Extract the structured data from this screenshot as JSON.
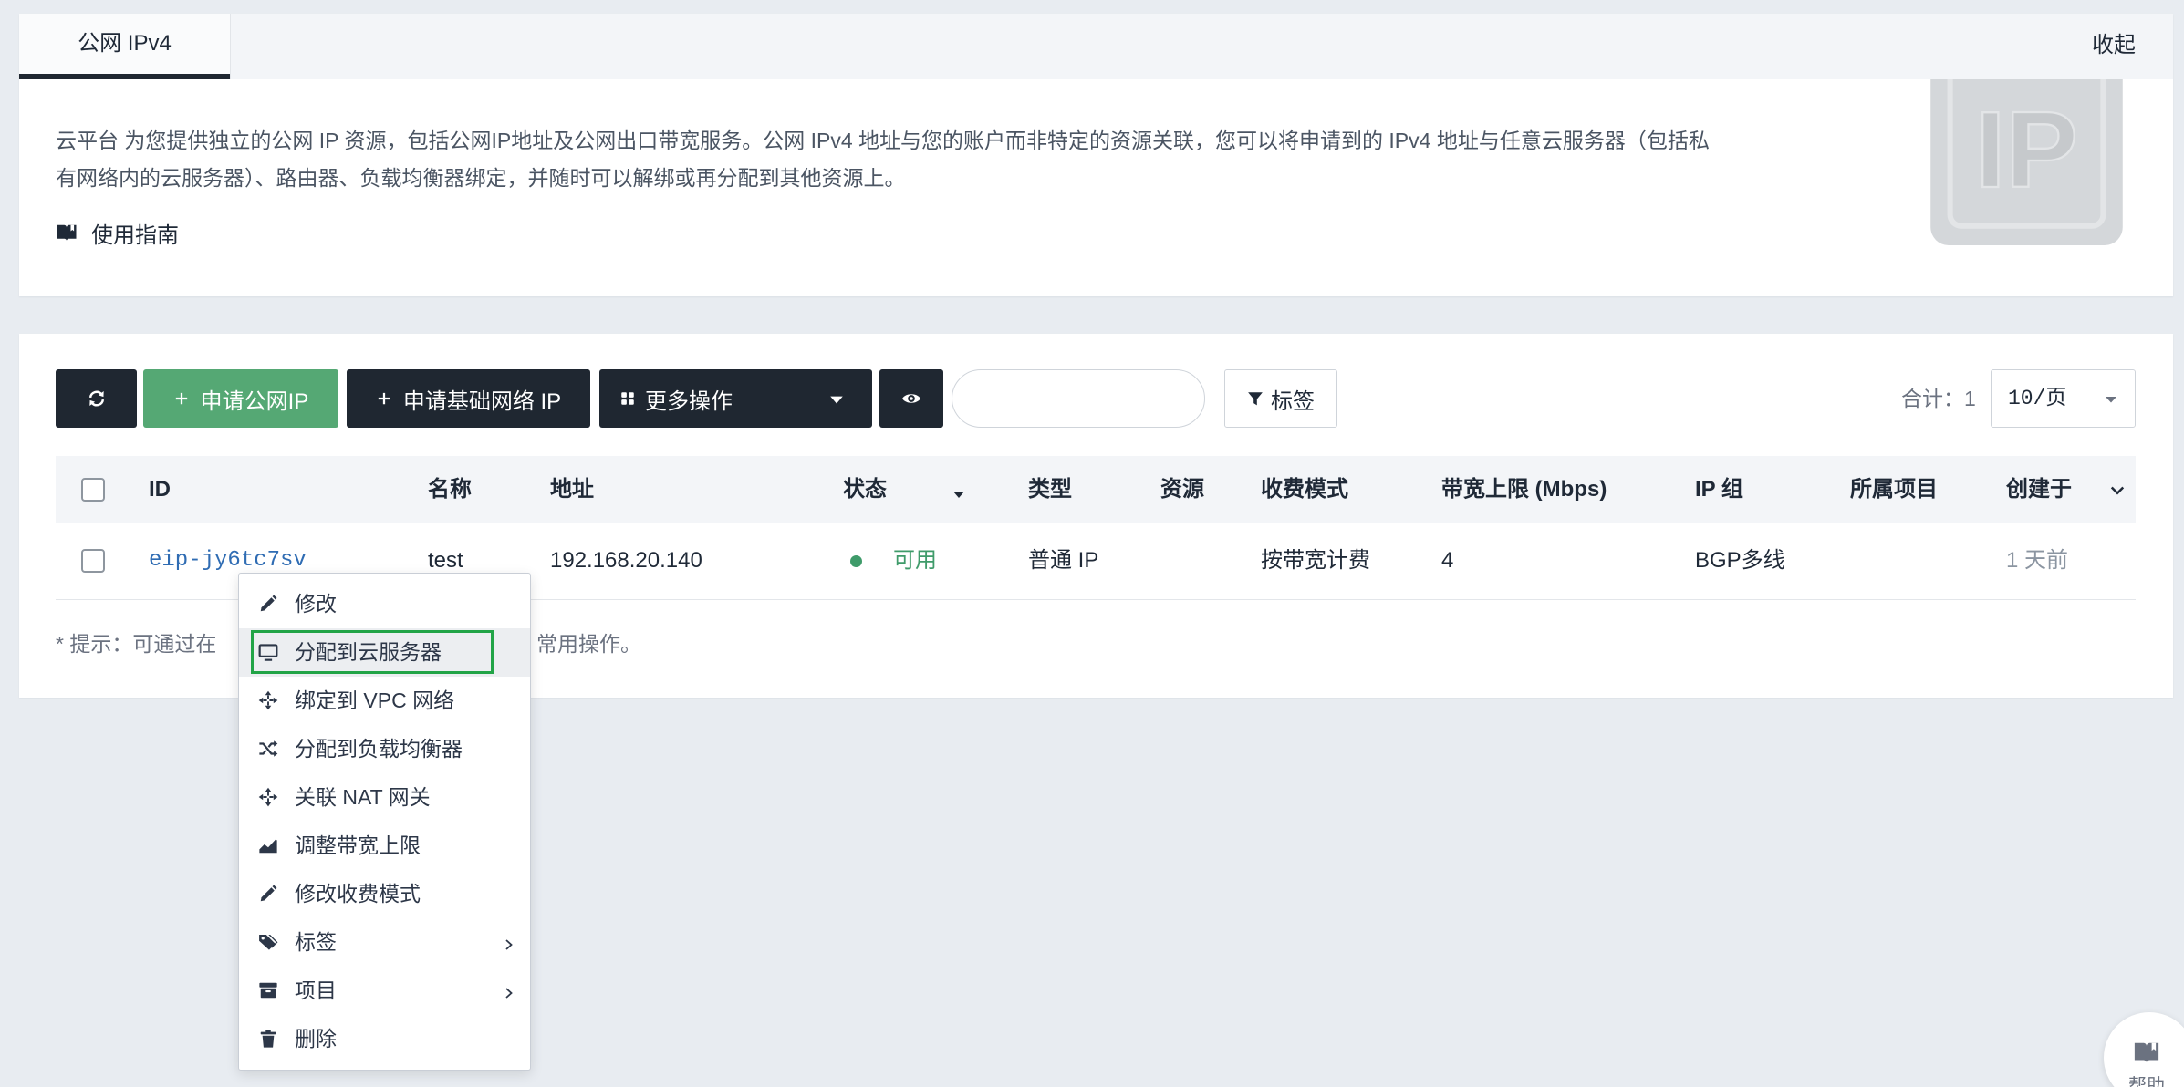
{
  "colors": {
    "page_bg": "#e8ecf1",
    "dark_button": "#1f2731",
    "accent_green": "#55a874",
    "link_blue": "#2f6cb3",
    "status_green": "#3f9b6a",
    "highlight_border": "#22a447"
  },
  "tabs": [
    {
      "label": "公网 IPv4",
      "active": true
    }
  ],
  "collapse_label": "收起",
  "intro": {
    "description_lines": [
      "云平台 为您提供独立的公网 IP 资源，包括公网IP地址及公网出口带宽服务。公网 IPv4 地址与您的账户而非特定的资源关联，您可以将申请到的 IPv4 地址与任意云服务器（包括私",
      "有网络内的云服务器）、路由器、负载均衡器绑定，并随时可以解绑或再分配到其他资源上。"
    ],
    "guide_label": "使用指南",
    "guide_icon": "book-icon",
    "logo_text": "IP"
  },
  "toolbar": {
    "refresh_icon": "refresh-icon",
    "apply_public_ip_label": "申请公网IP",
    "apply_basic_ip_label": "申请基础网络 IP",
    "more_actions_label": "更多操作",
    "view_icon": "eye-icon",
    "tag_filter_label": "标签",
    "total_label": "合计：1",
    "page_size": "10/页"
  },
  "table": {
    "columns": [
      "ID",
      "名称",
      "地址",
      "状态",
      "类型",
      "资源",
      "收费模式",
      "带宽上限 (Mbps)",
      "IP 组",
      "所属项目",
      "创建于"
    ],
    "rows": [
      {
        "id": "eip-jy6tc7sv",
        "name": "test",
        "address": "192.168.20.140",
        "status": "可用",
        "type": "普通 IP",
        "resource": "",
        "billing": "按带宽计费",
        "bandwidth": "4",
        "ip_group": "BGP多线",
        "project": "",
        "created": "1 天前"
      }
    ]
  },
  "hint": {
    "prefix": "* 提示：可通过在",
    "suffix": "常用操作。"
  },
  "context_menu": {
    "items": [
      {
        "label": "修改",
        "icon": "pencil-icon"
      },
      {
        "label": "分配到云服务器",
        "icon": "monitor-icon",
        "highlighted": true
      },
      {
        "label": "绑定到 VPC 网络",
        "icon": "move-arrows-icon"
      },
      {
        "label": "分配到负载均衡器",
        "icon": "shuffle-icon"
      },
      {
        "label": "关联 NAT 网关",
        "icon": "move-arrows-icon"
      },
      {
        "label": "调整带宽上限",
        "icon": "area-chart-icon"
      },
      {
        "label": "修改收费模式",
        "icon": "pencil-icon"
      },
      {
        "label": "标签",
        "icon": "tags-icon",
        "has_submenu": true
      },
      {
        "label": "项目",
        "icon": "archive-icon",
        "has_submenu": true
      },
      {
        "label": "删除",
        "icon": "trash-icon"
      }
    ]
  },
  "help": {
    "label": "帮助",
    "icon": "book-icon"
  }
}
